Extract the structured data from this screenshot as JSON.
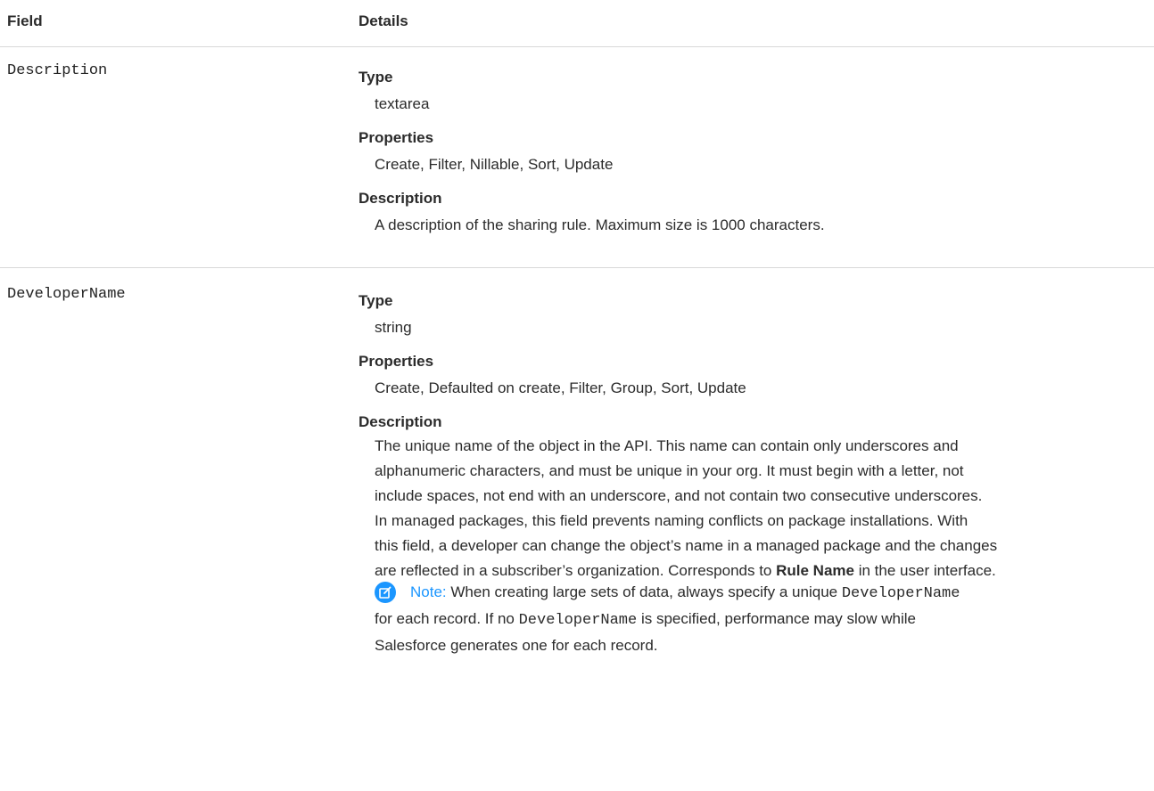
{
  "header": {
    "field": "Field",
    "details": "Details"
  },
  "rows": [
    {
      "name": "Description",
      "type_label": "Type",
      "type_value": "textarea",
      "properties_label": "Properties",
      "properties_value": "Create, Filter, Nillable, Sort, Update",
      "description_label": "Description",
      "description_value": "A description of the sharing rule. Maximum size is 1000 characters."
    },
    {
      "name": "DeveloperName",
      "type_label": "Type",
      "type_value": "string",
      "properties_label": "Properties",
      "properties_value": "Create, Defaulted on create, Filter, Group, Sort, Update",
      "description_label": "Description",
      "description_lines": [
        "The unique name of the object in the API. This name can contain only underscores and",
        "alphanumeric characters, and must be unique in your org. It must begin with a letter, not",
        "include spaces, not end with an underscore, and not contain two consecutive underscores.",
        "In managed packages, this field prevents naming conflicts on package installations. With",
        "this field, a developer can change the object’s name in a managed package and the changes"
      ],
      "description_last_prefix": "are reflected in a subscriber’s organization. Corresponds to ",
      "description_last_bold": "Rule Name",
      "description_last_suffix": " in the user interface.",
      "note": {
        "icon": "edit-note-icon",
        "label": "Note:",
        "line1_prefix": " When creating large sets of data, always specify a unique ",
        "line1_code": "DeveloperName",
        "line2_prefix": "for each record. If no ",
        "line2_code": "DeveloperName",
        "line2_suffix": " is specified, performance may slow while",
        "line3": "Salesforce generates one for each record."
      }
    }
  ],
  "colors": {
    "note_accent": "#1b96ff",
    "divider": "#d8d8d8"
  }
}
